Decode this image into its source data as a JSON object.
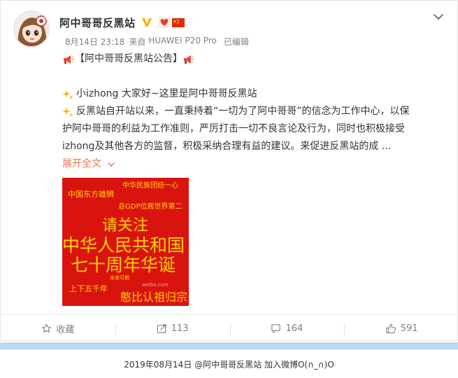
{
  "post": {
    "author": "阿中哥哥反黑站",
    "date": "8月14日 23:18",
    "source_prefix": "来自",
    "source": "HUAWEI P20 Pro",
    "edited": "已编辑",
    "announcement_title": "【阿中哥哥反黑站公告】",
    "greeting": "小izhong 大家好~这里是阿中哥哥反黑站",
    "body_line1_a": "反黑站自开站以来，一直秉持着",
    "body_line1_quote": "“一切为了阿中哥哥”",
    "body_line1_b": "的信念为工作中心，以保",
    "body_line2": "护阿中哥哥的利益为工作准则，严厉打击一切不良言论及行为，同时也积极接受",
    "body_line3": "izhong及其他各方的监督，积极采纳合理有益的建议。来促进反黑站的成 ...",
    "expand_label": "展开全文"
  },
  "poster": {
    "t1": "中华民族团结一心",
    "t2": "中国东方雄狮",
    "t3": "总GDP位居世界第二",
    "t4": "请关注",
    "t5": "中华人民共和国",
    "t6": "七十周年华诞",
    "t7": "未来可期",
    "t8": "上下五千年",
    "t9": "憨比认祖归宗",
    "watermark": "weibo.com"
  },
  "actions": {
    "favorite": "收藏",
    "repost": "113",
    "comment": "164",
    "like": "591"
  },
  "footer": {
    "text": "2019年08月14日 @阿中哥哥反黑站 加入微博O(∩_∩)O"
  },
  "colors": {
    "accent": "#eb7350",
    "meta": "#808080",
    "poster_bg": "#d9140f",
    "poster_text": "#ffd200",
    "bar": "#bed8f1"
  },
  "icons": {
    "avatar": "anime-girl-avatar",
    "verified": "yellow-v-badge",
    "heart": "red-heart-badge",
    "flag": "china-flag-icon",
    "more": "chevron-down-icon",
    "megaphone": "megaphone-icon",
    "sparkle": "sparkle-icon",
    "favorite": "star-icon",
    "repost": "share-arrow-icon",
    "comment": "comment-bubble-icon",
    "like": "thumbs-up-icon"
  }
}
